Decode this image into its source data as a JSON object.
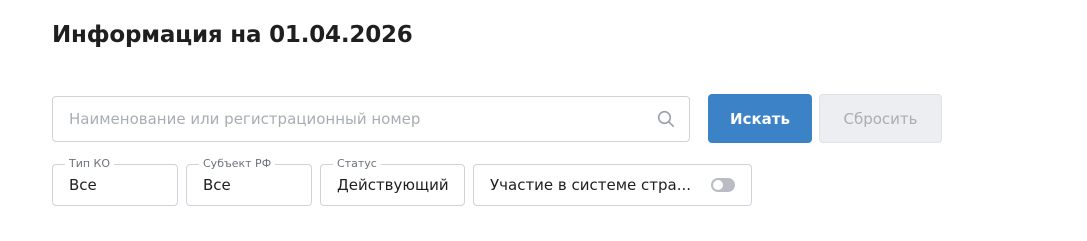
{
  "header": {
    "title": "Информация на 01.04.2026"
  },
  "search": {
    "placeholder": "Наименование или регистрационный номер",
    "value": "",
    "search_button_label": "Искать",
    "reset_button_label": "Сбросить"
  },
  "filters": [
    {
      "label": "Тип КО",
      "value": "Все"
    },
    {
      "label": "Субъект РФ",
      "value": "Все"
    },
    {
      "label": "Статус",
      "value": "Действующий"
    }
  ],
  "participation_toggle": {
    "label": "Участие в системе стра...",
    "checked": false
  },
  "colors": {
    "accent": "#3b82c6",
    "disabled_bg": "#eceef1",
    "border": "#cfd3d8"
  },
  "icons": {
    "search": "search-icon"
  }
}
